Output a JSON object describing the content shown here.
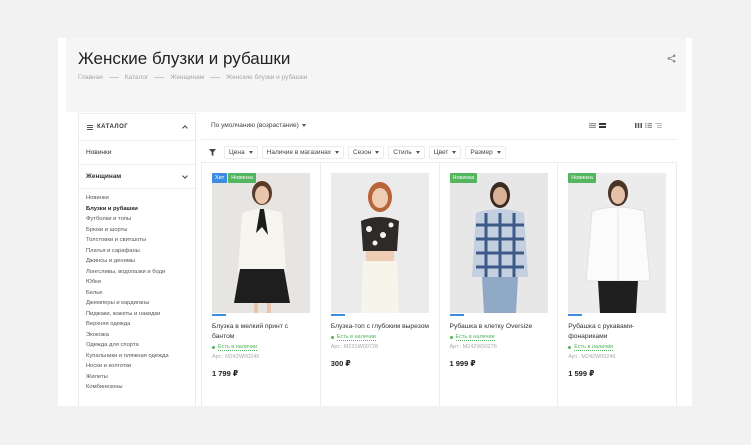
{
  "page": {
    "title": "Женские блузки и рубашки",
    "breadcrumbs": [
      "Главная",
      "Каталог",
      "Женщинам",
      "Женские блузки и рубашки"
    ]
  },
  "sidebar": {
    "header": "КАТАЛОГ",
    "top_item": "Новинки",
    "section": "Женщинам",
    "items": [
      "Новинки",
      "Блузки и рубашки",
      "Футболки и топы",
      "Брюки и шорты",
      "Толстовки и свитшоты",
      "Платья и сарафаны",
      "Джинсы и денимы",
      "Лонгсливы, водолазки и боди",
      "Юбки",
      "Белье",
      "Джемперы и кардиганы",
      "Пиджаки, жакеты и накидки",
      "Верхняя одежда",
      "Экокожа",
      "Одежда для спорта",
      "Купальники и пляжная одежда",
      "Носки и колготки",
      "Жилеты",
      "Комбинезоны"
    ],
    "active_index": 1
  },
  "toolbar": {
    "sort_label": "По умолчанию (возрастание)"
  },
  "filters": [
    "Цена",
    "Наличие в магазинах",
    "Сезон",
    "Стиль",
    "Цвет",
    "Размер"
  ],
  "colors": {
    "badge_hit": "#3b8de0",
    "badge_new": "#53b55e",
    "availability": "#53b55e"
  },
  "products": [
    {
      "badges": [
        {
          "text": "Хит",
          "color": "#3b8de0"
        },
        {
          "text": "Новинка",
          "color": "#53b55e"
        }
      ],
      "name": "Блузка в мелкий принт с бантом",
      "availability": "Есть в наличии",
      "article": "Арт.: М242W00245",
      "price": "1 799 ₽"
    },
    {
      "badges": [],
      "name": "Блузка-топ с глубоким вырезом",
      "availability": "Есть в наличии",
      "article": "Арт.: М231W00728",
      "price": "300 ₽"
    },
    {
      "badges": [
        {
          "text": "Новинка",
          "color": "#53b55e"
        }
      ],
      "name": "Рубашка в клетку Oversize",
      "availability": "Есть в наличии",
      "article": "Арт.: М242W00276",
      "price": "1 999 ₽"
    },
    {
      "badges": [
        {
          "text": "Новинка",
          "color": "#53b55e"
        }
      ],
      "name": "Рубашка с рукавами-фонариками",
      "availability": "Есть в наличии",
      "article": "Арт.: М242W00246",
      "price": "1 599 ₽"
    }
  ]
}
